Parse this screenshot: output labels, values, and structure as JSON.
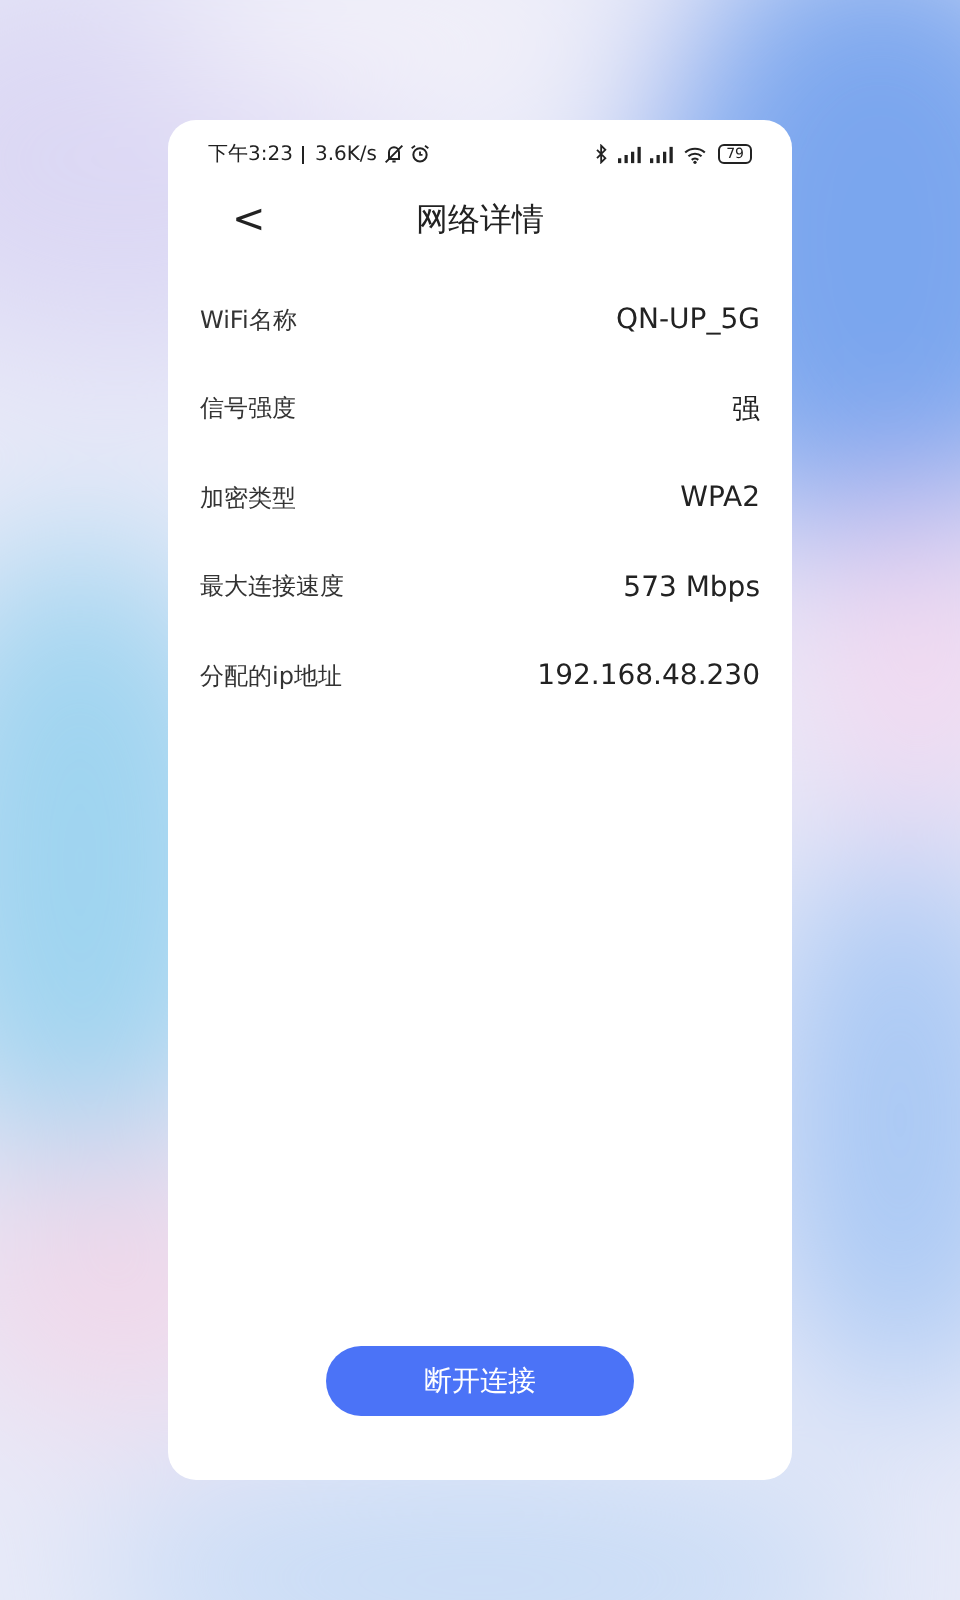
{
  "status_bar": {
    "time": "下午3:23",
    "speed": "3.6K/s",
    "battery": "79"
  },
  "header": {
    "back": "<",
    "title": "网络详情"
  },
  "details": [
    {
      "label": "WiFi名称",
      "value": "QN-UP_5G"
    },
    {
      "label": "信号强度",
      "value": "强"
    },
    {
      "label": "加密类型",
      "value": "WPA2"
    },
    {
      "label": "最大连接速度",
      "value": "573 Mbps"
    },
    {
      "label": "分配的ip地址",
      "value": "192.168.48.230"
    }
  ],
  "button": "断开连接"
}
